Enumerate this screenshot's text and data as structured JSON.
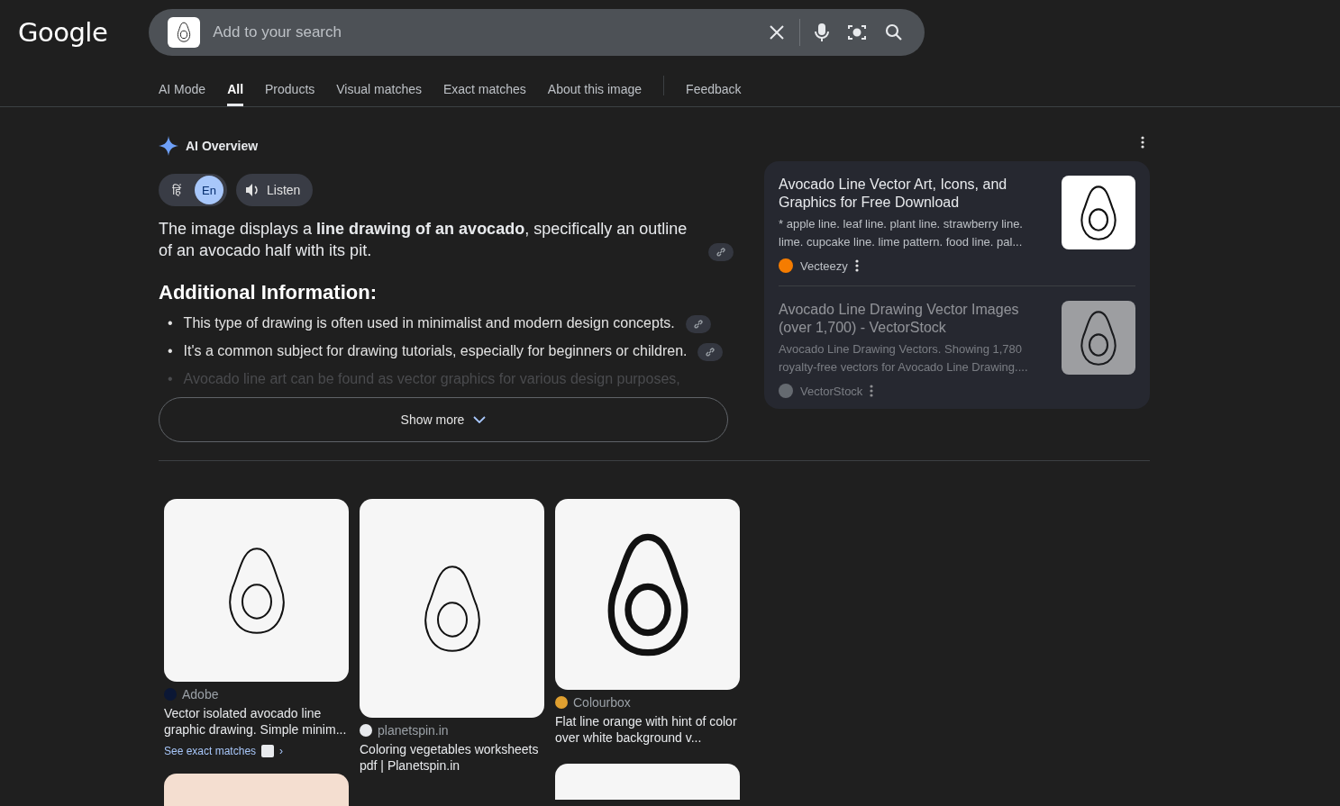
{
  "logo": "Google",
  "search": {
    "placeholder": "Add to your search"
  },
  "tabs": [
    {
      "label": "AI Mode",
      "selected": false
    },
    {
      "label": "All",
      "selected": true
    },
    {
      "label": "Products",
      "selected": false
    },
    {
      "label": "Visual matches",
      "selected": false
    },
    {
      "label": "Exact matches",
      "selected": false
    },
    {
      "label": "About this image",
      "selected": false
    },
    {
      "label": "Feedback",
      "selected": false,
      "kind": "separated"
    }
  ],
  "overview": {
    "title": "AI Overview",
    "languages": [
      {
        "label": "हिं",
        "selected": false
      },
      {
        "label": "En",
        "selected": true
      }
    ],
    "listen": "Listen",
    "summary": "The image displays a **line drawing of an avocado**, specifically an outline of an avocado half with its pit.",
    "heading": "Additional Information:",
    "bullets": [
      {
        "marker": "•",
        "text": "This type of drawing is often used in minimalist and modern design concepts.",
        "faded": false
      },
      {
        "marker": "•",
        "text": "It's a common subject for drawing tutorials, especially for beginners or children.",
        "faded": false
      },
      {
        "marker": "•",
        "text": "Avocado line art can be found as vector graphics for various design purposes,",
        "faded": true
      }
    ],
    "show_more": "Show more"
  },
  "sources": [
    {
      "title": "Avocado Line Vector Art, Icons, and Graphics for Free Download",
      "snippet": "* apple line. leaf line. plant line. strawberry line. lime. cupcake line. lime pattern. food line. pal...",
      "site": "Vecteezy",
      "faded": false
    },
    {
      "title": "Avocado Line Drawing Vector Images (over 1,700) - VectorStock",
      "snippet": "Avocado Line Drawing Vectors. Showing 1,780 royalty-free vectors for Avocado Line Drawing....",
      "site": "VectorStock",
      "faded": true
    }
  ],
  "results": [
    {
      "site": "Adobe",
      "title": "Vector isolated avocado line graphic drawing. Simple minim...",
      "link": "See exact matches",
      "link_arrow": "›"
    },
    {
      "site": "planetspin.in",
      "title": "Coloring vegetables worksheets pdf | Planetspin.in"
    },
    {
      "site": "Colourbox",
      "title": "Flat line orange with hint of color over white background v..."
    }
  ]
}
